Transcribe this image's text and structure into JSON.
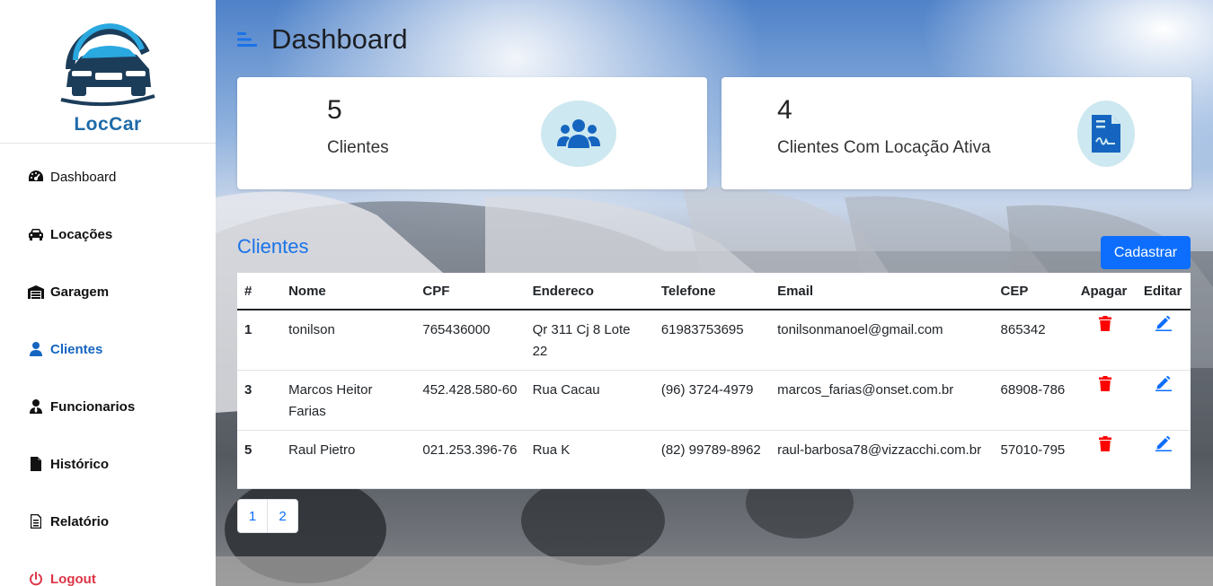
{
  "sidebar": {
    "logo_text": "LocCar",
    "items": [
      {
        "label": "Dashboard",
        "icon": "gauge-icon"
      },
      {
        "label": "Locações",
        "icon": "car-icon"
      },
      {
        "label": "Garagem",
        "icon": "warehouse-icon"
      },
      {
        "label": "Clientes",
        "icon": "user-icon"
      },
      {
        "label": "Funcionarios",
        "icon": "user-tie-icon"
      },
      {
        "label": "Histórico",
        "icon": "file-icon"
      },
      {
        "label": "Relatório",
        "icon": "file-lines-icon"
      },
      {
        "label": "Logout",
        "icon": "power-icon"
      }
    ]
  },
  "header": {
    "title": "Dashboard"
  },
  "cards": [
    {
      "value": "5",
      "label": "Clientes",
      "icon": "users-icon"
    },
    {
      "value": "4",
      "label": "Clientes Com Locação Ativa",
      "icon": "contract-icon"
    }
  ],
  "clients_section": {
    "title": "Clientes",
    "add_button": "Cadastrar",
    "columns": [
      "#",
      "Nome",
      "CPF",
      "Endereco",
      "Telefone",
      "Email",
      "CEP",
      "Apagar",
      "Editar"
    ],
    "rows": [
      {
        "id": "1",
        "nome": "tonilson",
        "cpf": "765436000",
        "endereco": "Qr 311 Cj 8 Lote 22",
        "telefone": "61983753695",
        "email": "tonilsonmanoel@gmail.com",
        "cep": "865342"
      },
      {
        "id": "3",
        "nome": "Marcos Heitor Farias",
        "cpf": "452.428.580-60",
        "endereco": "Rua Cacau",
        "telefone": "(96) 3724-4979",
        "email": "marcos_farias@onset.com.br",
        "cep": "68908-786"
      },
      {
        "id": "5",
        "nome": "Raul Pietro",
        "cpf": "021.253.396-76",
        "endereco": "Rua K",
        "telefone": "(82) 99789-8962",
        "email": "raul-barbosa78@vizzacchi.com.br",
        "cep": "57010-795"
      }
    ]
  },
  "pagination": {
    "pages": [
      "1",
      "2"
    ]
  },
  "colors": {
    "primary": "#0d6efd",
    "danger": "#ff0000",
    "active_nav": "#1565c0",
    "logout": "#dc3545"
  }
}
